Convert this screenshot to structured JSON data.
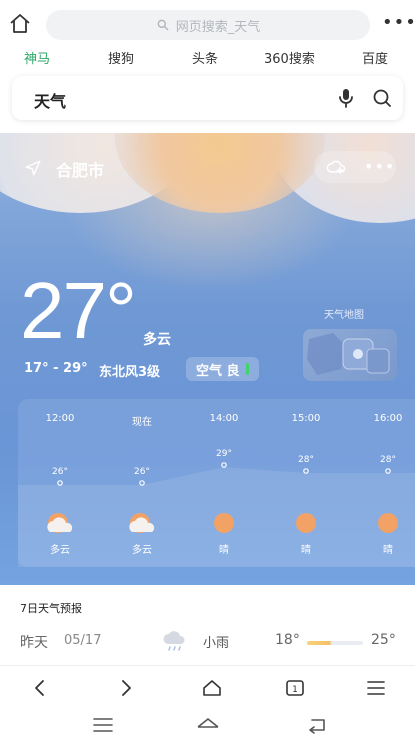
{
  "browser": {
    "url_placeholder": "网页搜索_天气",
    "engines": [
      "神马",
      "搜狗",
      "头条",
      "360搜索",
      "百度"
    ],
    "active_engine_color": "#2aa86a",
    "search_query": "天气"
  },
  "weather": {
    "city": "合肥市",
    "temperature": "27°",
    "condition": "多云",
    "range": "17° - 29°",
    "wind": "东北风3级",
    "air_label": "空气 良",
    "map_label": "天气地图",
    "hourly": [
      {
        "time": "12:00",
        "temp": "26°",
        "temp_value": 26,
        "cond": "多云",
        "icon": "cloudy-icon"
      },
      {
        "time": "现在",
        "temp": "26°",
        "temp_value": 26,
        "cond": "多云",
        "icon": "cloudy-icon"
      },
      {
        "time": "14:00",
        "temp": "29°",
        "temp_value": 29,
        "cond": "晴",
        "icon": "sunny-icon"
      },
      {
        "time": "15:00",
        "temp": "28°",
        "temp_value": 28,
        "cond": "晴",
        "icon": "sunny-icon"
      },
      {
        "time": "16:00",
        "temp": "28°",
        "temp_value": 28,
        "cond": "晴",
        "icon": "sunny-icon"
      }
    ]
  },
  "forecast": {
    "title": "7日天气预报",
    "day": "昨天",
    "date": "05/17",
    "cond": "小雨",
    "low": "18°",
    "high": "25°"
  }
}
